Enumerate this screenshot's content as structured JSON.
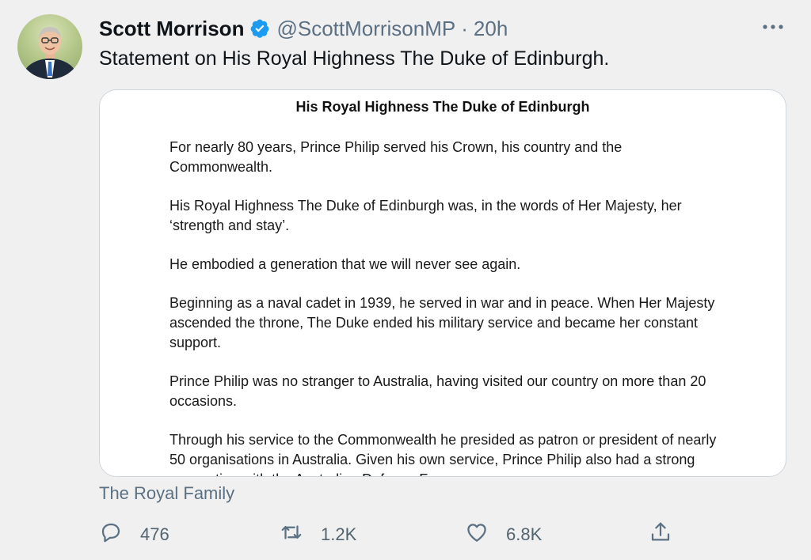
{
  "tweet": {
    "author_name": "Scott Morrison",
    "handle": "@ScottMorrisonMP",
    "separator": "·",
    "time": "20h",
    "text": "Statement on His Royal Highness The Duke of Edinburgh."
  },
  "icons": {
    "verified": "verified-badge-icon",
    "more": "more-options-icon",
    "reply": "reply-icon",
    "retweet": "retweet-icon",
    "like": "like-icon",
    "share": "share-icon"
  },
  "colors": {
    "verified": "#1d9bf0",
    "secondary_text": "#5b7083",
    "background": "#f0f0f0"
  },
  "card": {
    "title": "His Royal Highness The Duke of Edinburgh",
    "paragraphs": [
      "For nearly 80 years, Prince Philip served his Crown, his country and the Commonwealth.",
      "His Royal Highness The Duke of Edinburgh was, in the words of Her Majesty, her ‘strength and stay’.",
      "He embodied a generation that we will never see again.",
      "Beginning as a naval cadet in 1939, he served in war and in peace. When Her Majesty ascended the throne, The Duke ended his military service and became her constant support.",
      "Prince Philip was no stranger to Australia, having visited our country on more than 20 occasions.",
      "Through his service to the Commonwealth he presided as patron or president of nearly 50 organisations in Australia. Given his own service, Prince Philip also had a strong connection with the Australian Defence Force."
    ]
  },
  "source_label": "The Royal Family",
  "actions": {
    "reply_count": "476",
    "retweet_count": "1.2K",
    "like_count": "6.8K"
  }
}
